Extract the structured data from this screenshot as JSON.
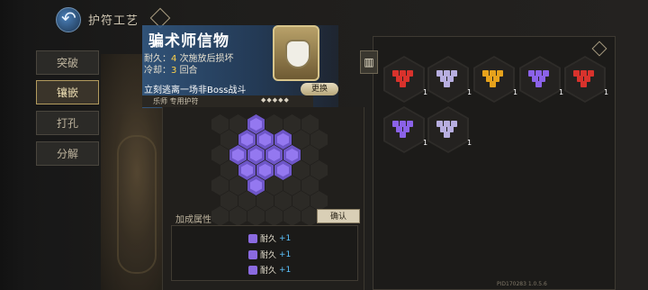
{
  "header": {
    "title": "护符工艺"
  },
  "tabs": [
    {
      "label": "突破"
    },
    {
      "label": "镶嵌"
    },
    {
      "label": "打孔"
    },
    {
      "label": "分解"
    }
  ],
  "amulet": {
    "name": "骗术师信物",
    "durability_label": "耐久：",
    "durability_value": "4",
    "durability_suffix": "次施放后损坏",
    "cooldown_label": "冷却：",
    "cooldown_value": "3",
    "cooldown_suffix": "回合",
    "description": "立刻逃离一场非Boss战斗",
    "change_label": "更换",
    "tag": "乐师 专用护符"
  },
  "bonus": {
    "label": "加成属性",
    "confirm_label": "确认",
    "rows": [
      {
        "stat": "耐久",
        "value": "+1"
      },
      {
        "stat": "耐久",
        "value": "+1"
      },
      {
        "stat": "耐久",
        "value": "+1"
      }
    ]
  },
  "inventory": [
    {
      "color": "#d8322c",
      "count": "1"
    },
    {
      "color": "#b7aee0",
      "count": "1"
    },
    {
      "color": "#e6a21c",
      "count": "1"
    },
    {
      "color": "#8b62e8",
      "count": "1"
    },
    {
      "color": "#d8322c",
      "count": "1"
    },
    {
      "color": "#8b62e8",
      "count": "1"
    },
    {
      "color": "#b7aee0",
      "count": "1"
    }
  ],
  "footer": {
    "build": "PID170283  1.0.5.6"
  }
}
